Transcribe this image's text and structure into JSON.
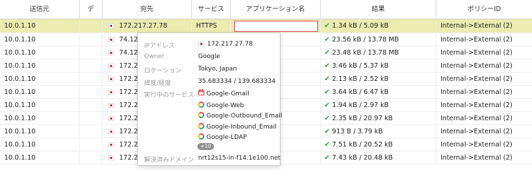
{
  "columns": {
    "source": "送信元",
    "dest2": "デ",
    "dest": "宛先",
    "service": "サービス",
    "app": "アプリケーション名",
    "result": "結果",
    "policy": "ポリシーID"
  },
  "rows": [
    {
      "src": "10.0.1.10",
      "dst": "172.217.27.78",
      "svc": "HTTPS",
      "res": "1.34 kB / 5.09 kB",
      "pol": "Internal->External (2)",
      "sel": true
    },
    {
      "src": "10.0.1.10",
      "dst": "74.125.",
      "svc": "",
      "res": "23.56 kB / 13.78 MB",
      "pol": "Internal->External (2)"
    },
    {
      "src": "10.0.1.10",
      "dst": "74.125.",
      "svc": "",
      "res": "23.48 kB / 13.78 MB",
      "pol": "Internal->External (2)"
    },
    {
      "src": "10.0.1.10",
      "dst": "172.217",
      "svc": "",
      "res": "3.46 kB / 5.37 kB",
      "pol": "Internal->External (2)"
    },
    {
      "src": "10.0.1.10",
      "dst": "172.217",
      "svc": "",
      "res": "2.13 kB / 2.52 kB",
      "pol": "Internal->External (2)"
    },
    {
      "src": "10.0.1.10",
      "dst": "172.217",
      "svc": "",
      "res": "3.64 kB / 6.47 kB",
      "pol": "Internal->External (2)"
    },
    {
      "src": "10.0.1.10",
      "dst": "172.217",
      "svc": "",
      "res": "1.94 kB / 2.97 kB",
      "pol": "Internal->External (2)"
    },
    {
      "src": "10.0.1.10",
      "dst": "172.217",
      "svc": "",
      "res": "2.35 kB / 20.97 kB",
      "pol": "Internal->External (2)"
    },
    {
      "src": "10.0.1.10",
      "dst": "172.217",
      "svc": "",
      "res": "913 B / 3.79 kB",
      "pol": "Internal->External (2)"
    },
    {
      "src": "10.0.1.10",
      "dst": "172.217",
      "svc": "",
      "res": "7.51 kB / 20.52 kB",
      "pol": "Internal->External (2)"
    },
    {
      "src": "10.0.1.10",
      "dst": "172.217",
      "svc": "",
      "res": "7.43 kB / 20.48 kB",
      "pol": "Internal->External (2)"
    }
  ],
  "popup": {
    "ip_label": "IPアドレス",
    "ip_value": "172.217.27.78",
    "owner_label": "Owner",
    "owner_value": "Google",
    "location_label": "ロケーション",
    "location_value": "Tokyo, Japan",
    "latlon_label": "緯度/経度",
    "latlon_value": "35.683334 / 139.683334",
    "services_label": "実行中のサービス",
    "services": [
      {
        "name": "Google-Gmail",
        "icon": "gmail-icon"
      },
      {
        "name": "Google-Web",
        "icon": "google-icon"
      },
      {
        "name": "Google-Outbound_Email",
        "icon": "google-icon"
      },
      {
        "name": "Google-Inbound_Email",
        "icon": "google-icon"
      },
      {
        "name": "Google-LDAP",
        "icon": "google-icon"
      }
    ],
    "more_badge": "+10",
    "resolved_label": "解決済みドメイン",
    "resolved_value": "nrt12s15-in-f14.1e100.net"
  },
  "colors": {
    "selected_row": "#ecebb0",
    "check": "#2aa84a",
    "app_box_border": "#e0465a"
  }
}
